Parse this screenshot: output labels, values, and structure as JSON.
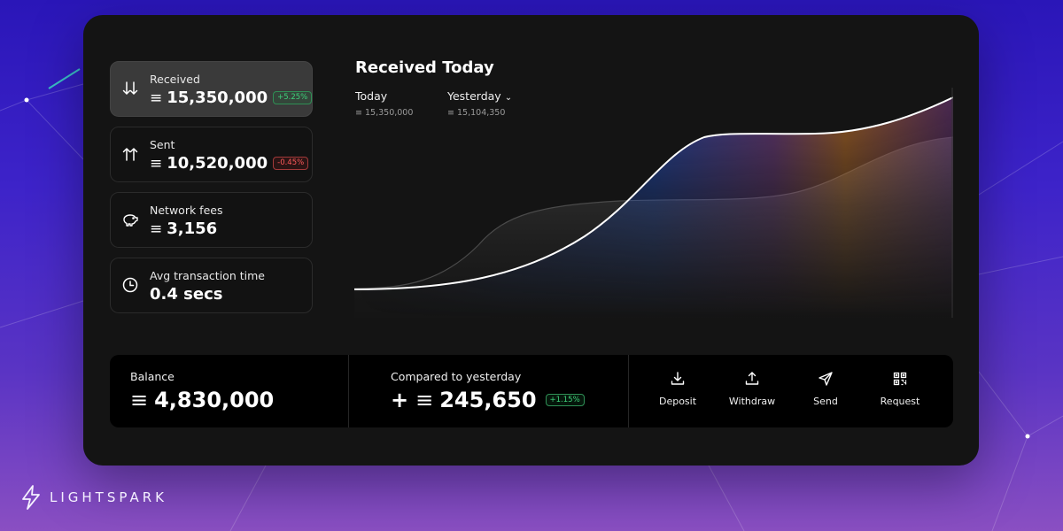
{
  "cards": [
    {
      "label": "Received",
      "value": "15,350,000",
      "badge": "+5.25%",
      "trend": "up",
      "icon": "arrows-down-icon",
      "active": true
    },
    {
      "label": "Sent",
      "value": "10,520,000",
      "badge": "-0.45%",
      "trend": "down",
      "icon": "arrows-up-icon",
      "active": false
    },
    {
      "label": "Network fees",
      "value": "3,156",
      "icon": "piggy-bank-icon"
    },
    {
      "label": "Avg transaction time",
      "value": "0.4 secs",
      "icon": "clock-icon"
    }
  ],
  "chart": {
    "title": "Received Today",
    "today_label": "Today",
    "today_value": "15,350,000",
    "yesterday_label": "Yesterday",
    "yesterday_value": "15,104,350"
  },
  "bottom": {
    "balance_label": "Balance",
    "balance_value": "4,830,000",
    "compare_label": "Compared to yesterday",
    "compare_prefix": "+",
    "compare_value": "245,650",
    "compare_badge": "+1.15%"
  },
  "actions": [
    {
      "label": "Deposit",
      "icon": "download-icon"
    },
    {
      "label": "Withdraw",
      "icon": "upload-icon"
    },
    {
      "label": "Send",
      "icon": "send-icon"
    },
    {
      "label": "Request",
      "icon": "qr-code-icon"
    }
  ],
  "brand": {
    "name": "LIGHTSPARK"
  },
  "currency_symbol": "≡",
  "colors": {
    "background": "#3d23c9",
    "panel": "#141414",
    "positive": "#3fd07a",
    "negative": "#ff5a5a",
    "chart_blue": "#1e5ad8",
    "chart_orange": "#d8782a"
  }
}
